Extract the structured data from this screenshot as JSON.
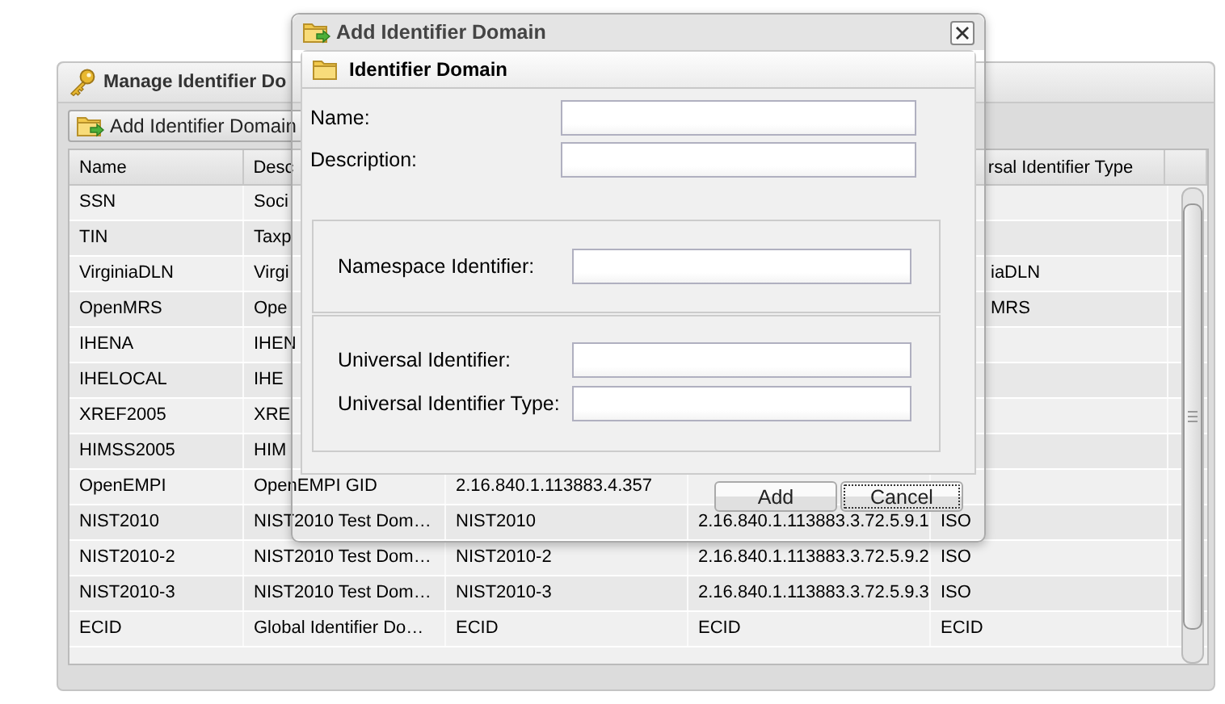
{
  "manage_panel": {
    "title": "Manage Identifier Do",
    "toolbar_button": "Add Identifier Domain",
    "columns": [
      "Name",
      "Desc",
      null,
      null,
      "rsal Identifier Type"
    ],
    "rows": [
      {
        "kind": "covered",
        "cells": [
          "SSN",
          "Soci",
          null,
          null,
          null
        ]
      },
      {
        "kind": "covered",
        "cells": [
          "TIN",
          "Taxp",
          null,
          null,
          null
        ]
      },
      {
        "kind": "covered",
        "cells": [
          "VirginiaDLN",
          "Virgi",
          null,
          null,
          "iaDLN"
        ]
      },
      {
        "kind": "covered",
        "cells": [
          "OpenMRS",
          "Ope",
          null,
          null,
          "MRS"
        ]
      },
      {
        "kind": "covered",
        "cells": [
          "IHENA",
          "IHEN",
          null,
          null,
          null
        ]
      },
      {
        "kind": "covered",
        "cells": [
          "IHELOCAL",
          "IHE",
          null,
          null,
          null
        ]
      },
      {
        "kind": "covered",
        "cells": [
          "XREF2005",
          "XRE",
          null,
          null,
          null
        ]
      },
      {
        "kind": "covered",
        "cells": [
          "HIMSS2005",
          "HIM",
          null,
          null,
          null
        ]
      },
      {
        "kind": "faded",
        "cells": [
          "OpenEMPI",
          "OpenEMPI GID",
          "2.16.840.1.113883.4.357",
          null,
          null
        ]
      },
      {
        "kind": "faded",
        "cells": [
          "NIST2010",
          "NIST2010 Test Dom…",
          "NIST2010",
          "2.16.840.1.113883.3.72.5.9.1",
          "ISO"
        ]
      },
      {
        "kind": "full",
        "cells": [
          "NIST2010-2",
          "NIST2010 Test Dom…",
          "NIST2010-2",
          "2.16.840.1.113883.3.72.5.9.2",
          "ISO"
        ]
      },
      {
        "kind": "full",
        "cells": [
          "NIST2010-3",
          "NIST2010 Test Dom…",
          "NIST2010-3",
          "2.16.840.1.113883.3.72.5.9.3",
          "ISO"
        ]
      },
      {
        "kind": "full",
        "cells": [
          "ECID",
          "Global Identifier Do…",
          "ECID",
          "ECID",
          "ECID"
        ]
      }
    ]
  },
  "dialog": {
    "title": "Add Identifier Domain",
    "panel_title": "Identifier Domain",
    "fields": [
      {
        "label": "Name:"
      },
      {
        "label": "Description:"
      }
    ],
    "groups": [
      [
        {
          "label": "Namespace Identifier:"
        }
      ],
      [
        {
          "label": "Universal Identifier:"
        },
        {
          "label": "Universal Identifier Type:"
        }
      ]
    ],
    "buttons": [
      {
        "label": "Add",
        "focused": false
      },
      {
        "label": "Cancel",
        "focused": true
      }
    ]
  }
}
